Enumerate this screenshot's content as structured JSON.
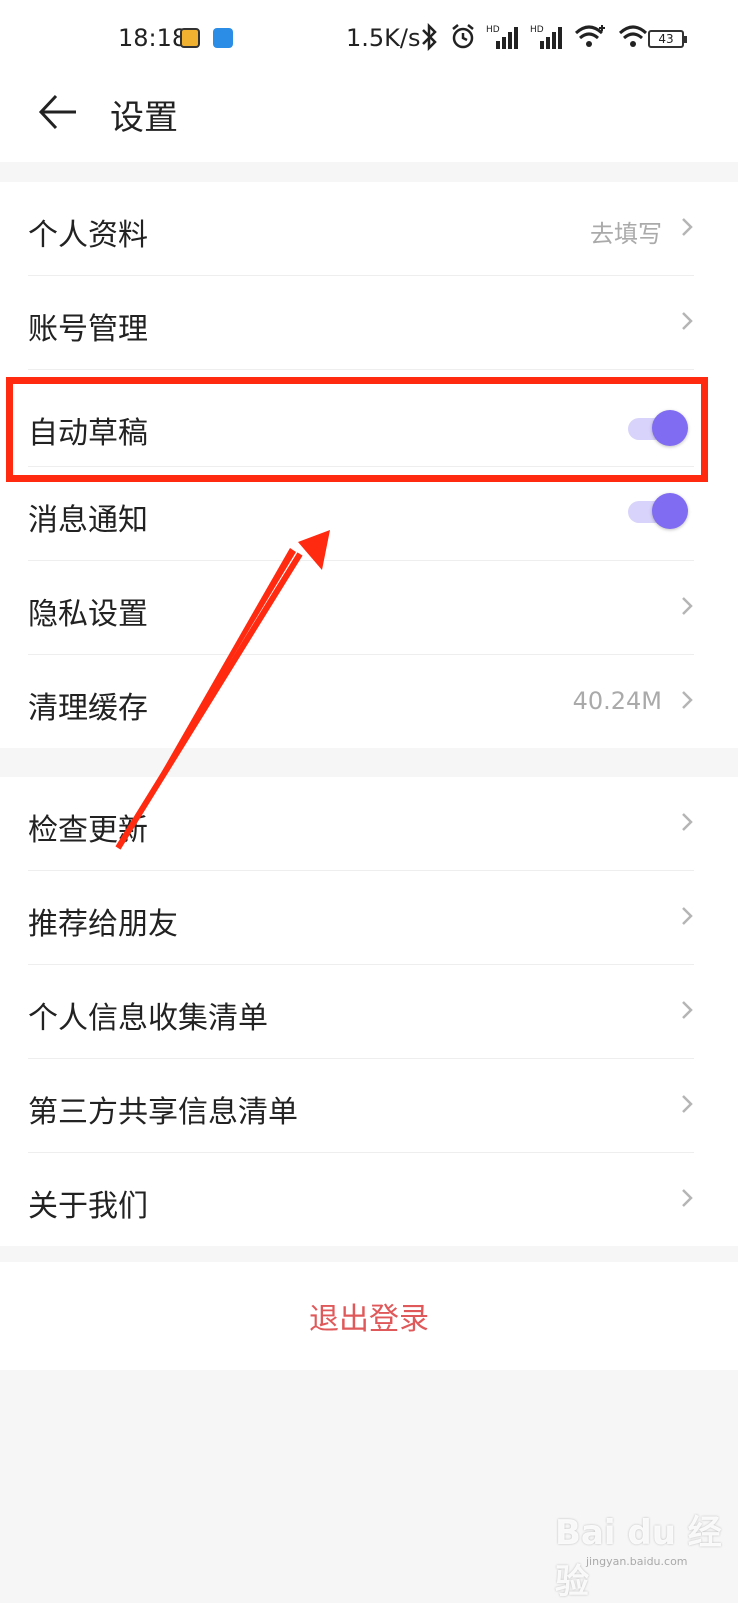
{
  "status_bar": {
    "time": "18:18",
    "net_speed": "1.5K/s",
    "battery": "43",
    "icons": [
      "app-icon-1",
      "app-icon-2",
      "bluetooth-icon",
      "alarm-icon",
      "hd-signal-icon",
      "hd-signal-icon",
      "wifi-plus-icon",
      "wifi-icon",
      "battery-icon"
    ]
  },
  "header": {
    "title": "设置",
    "back_icon": "back-arrow-icon"
  },
  "groups": [
    {
      "items": [
        {
          "label": "个人资料",
          "value": "去填写",
          "type": "link"
        },
        {
          "label": "账号管理",
          "value": "",
          "type": "link"
        },
        {
          "label": "自动草稿",
          "type": "toggle",
          "on": true
        },
        {
          "label": "消息通知",
          "type": "toggle",
          "on": true
        },
        {
          "label": "隐私设置",
          "type": "link"
        },
        {
          "label": "清理缓存",
          "value": "40.24M",
          "type": "link"
        }
      ]
    },
    {
      "items": [
        {
          "label": "检查更新",
          "type": "link"
        },
        {
          "label": "推荐给朋友",
          "type": "link"
        },
        {
          "label": "个人信息收集清单",
          "type": "link"
        },
        {
          "label": "第三方共享信息清单",
          "type": "link"
        },
        {
          "label": "关于我们",
          "type": "link"
        }
      ]
    }
  ],
  "logout": {
    "label": "退出登录"
  },
  "colors": {
    "toggle_on": "#7f6cf2",
    "toggle_track": "#d8d3fa",
    "logout_text": "#e0595a",
    "annotation": "#ff2a10"
  },
  "watermark": {
    "text": "Bai du 经验",
    "sub": "jingyan.baidu.com"
  }
}
